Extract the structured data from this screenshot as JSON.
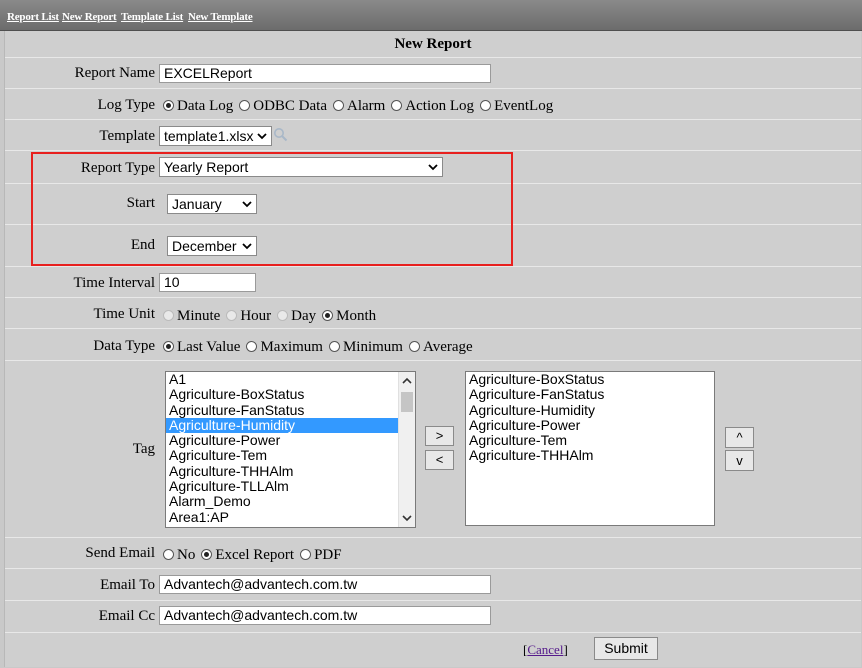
{
  "nav": {
    "report_list": "Report List",
    "new_report": "New Report",
    "template_list": "Template List",
    "new_template": "New Template"
  },
  "form": {
    "title": "New Report",
    "report_name": {
      "label": "Report Name",
      "value": "EXCELReport"
    },
    "log_type": {
      "label": "Log Type",
      "options": [
        "Data Log",
        "ODBC Data",
        "Alarm",
        "Action Log",
        "EventLog"
      ],
      "selected": "Data Log"
    },
    "template": {
      "label": "Template",
      "value": "template1.xlsx"
    },
    "report_type": {
      "label": "Report Type",
      "value": "Yearly Report"
    },
    "start": {
      "label": "Start",
      "value": "January"
    },
    "end": {
      "label": "End",
      "value": "December"
    },
    "time_interval": {
      "label": "Time Interval",
      "value": "10"
    },
    "time_unit": {
      "label": "Time Unit",
      "options": [
        "Minute",
        "Hour",
        "Day",
        "Month"
      ],
      "selected": "Month"
    },
    "data_type": {
      "label": "Data Type",
      "options": [
        "Last Value",
        "Maximum",
        "Minimum",
        "Average"
      ],
      "selected": "Last Value"
    },
    "tag": {
      "label": "Tag",
      "available": [
        "A1",
        "Agriculture-BoxStatus",
        "Agriculture-FanStatus",
        "Agriculture-Humidity",
        "Agriculture-Power",
        "Agriculture-Tem",
        "Agriculture-THHAlm",
        "Agriculture-TLLAlm",
        "Alarm_Demo",
        "Area1:AP"
      ],
      "available_selected": "Agriculture-Humidity",
      "chosen": [
        "Agriculture-BoxStatus",
        "Agriculture-FanStatus",
        "Agriculture-Humidity",
        "Agriculture-Power",
        "Agriculture-Tem",
        "Agriculture-THHAlm"
      ],
      "add_label": ">",
      "remove_label": "<",
      "up_label": "^",
      "down_label": "v"
    },
    "send_email": {
      "label": "Send Email",
      "options": [
        "No",
        "Excel Report",
        "PDF"
      ],
      "selected": "Excel Report"
    },
    "email_to": {
      "label": "Email To",
      "value": "Advantech@advantech.com.tw"
    },
    "email_cc": {
      "label": "Email Cc",
      "value": "Advantech@advantech.com.tw"
    },
    "cancel_label": "Cancel",
    "submit_label": "Submit"
  },
  "colors": {
    "highlight": "#e8201e",
    "selection": "#3399ff"
  }
}
